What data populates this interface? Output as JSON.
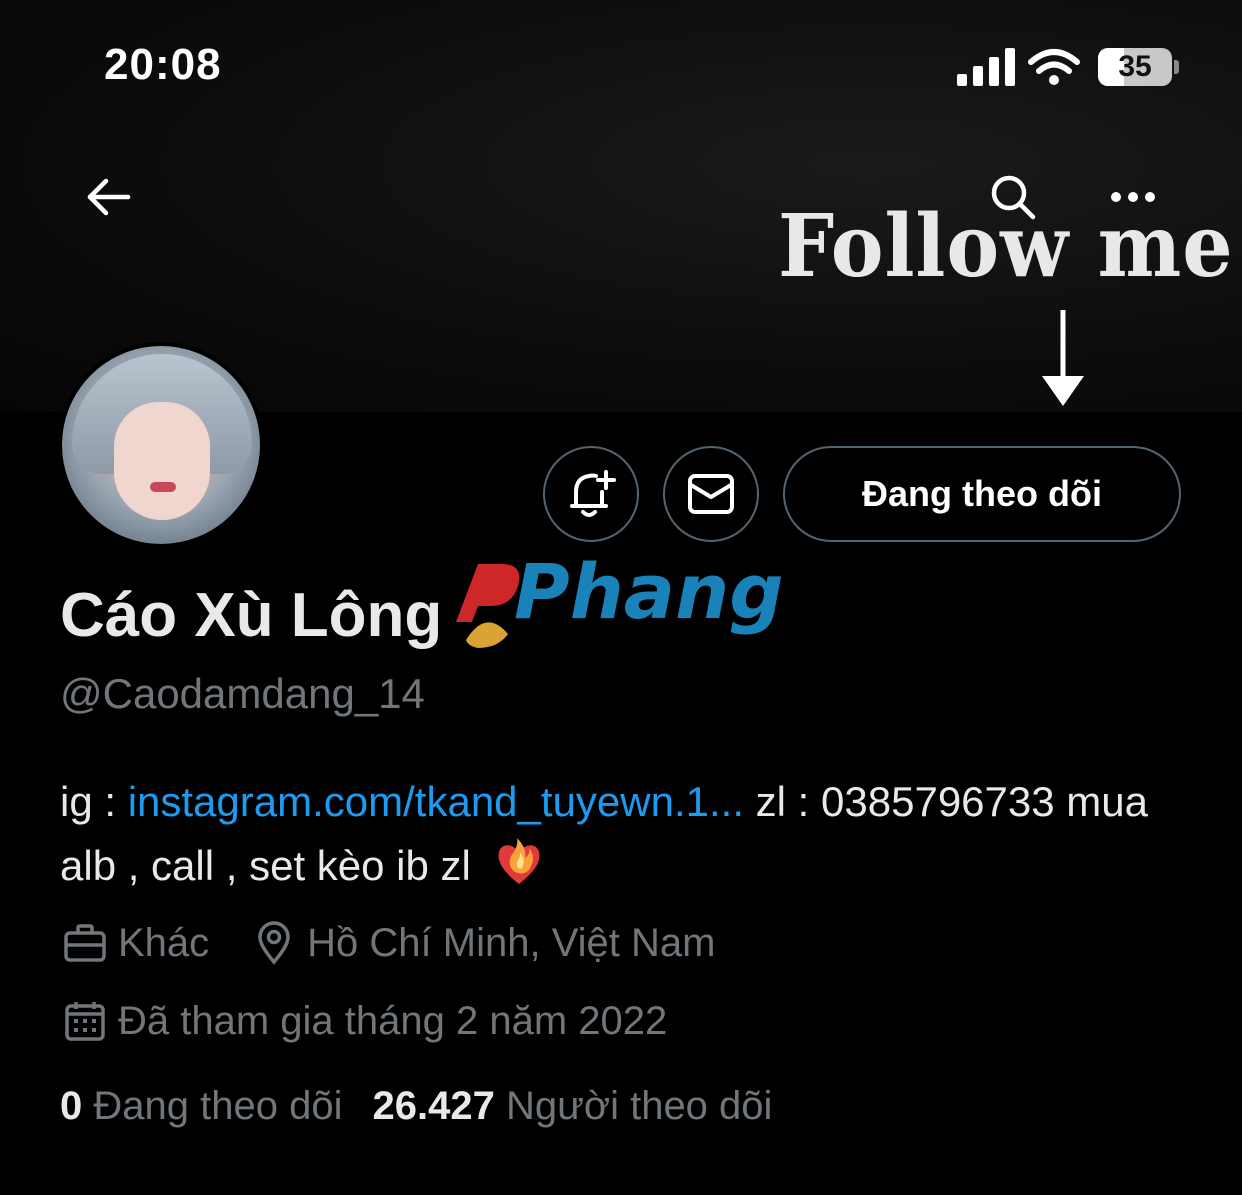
{
  "status_bar": {
    "time": "20:08",
    "battery": "35",
    "icons": [
      "signal-icon",
      "wifi-icon",
      "battery-icon"
    ]
  },
  "banner": {
    "text": "Follow me"
  },
  "nav": {
    "icons": [
      "back-arrow-icon",
      "search-icon",
      "more-icon"
    ]
  },
  "actions": {
    "follow_label": "Đang theo dõi",
    "icons": [
      "bell-plus-icon",
      "mail-icon"
    ]
  },
  "profile": {
    "display_name": "Cáo Xù Lông",
    "handle": "@Caodamdang_14",
    "bio_prefix": "ig : ",
    "bio_link": "instagram.com/tkand_tuyewn.1...",
    "bio_suffix": " zl : 0385796733 mua alb , call , set kèo ib zl",
    "category": "Khác",
    "location": "Hồ Chí Minh, Việt Nam",
    "joined": "Đã tham gia tháng 2 năm 2022",
    "following_count": "0",
    "following_label": "Đang theo dõi",
    "followers_count": "26.427",
    "followers_label": "Người theo dõi"
  },
  "watermark": {
    "text": "Phang"
  },
  "colors": {
    "background": "#000000",
    "text": "#e7e9ea",
    "muted": "#71767b",
    "link": "#1d9bf0",
    "border": "#536471"
  }
}
